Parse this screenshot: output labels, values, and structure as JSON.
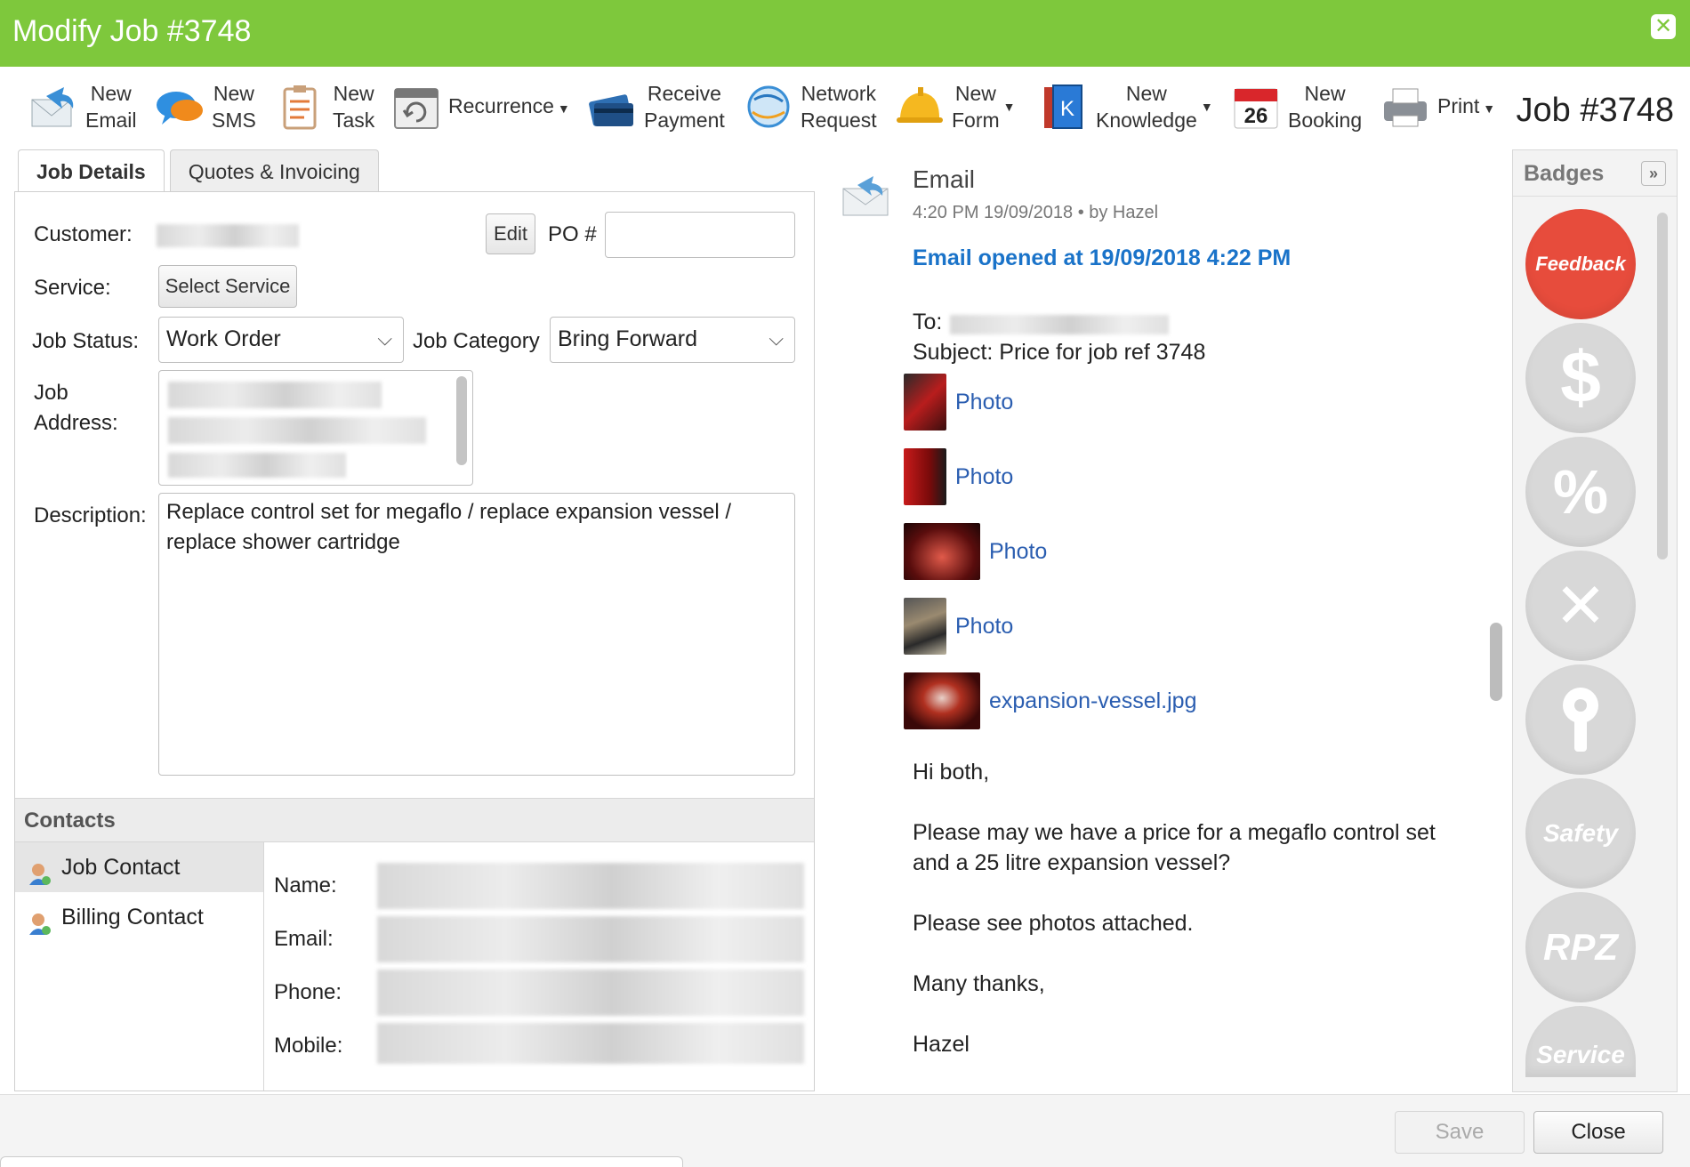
{
  "window": {
    "title": "Modify Job #3748",
    "close_glyph": "✕"
  },
  "toolbar": {
    "items": [
      {
        "l1": "New",
        "l2": "Email",
        "icon": "email-icon"
      },
      {
        "l1": "New",
        "l2": "SMS",
        "icon": "sms-icon"
      },
      {
        "l1": "New",
        "l2": "Task",
        "icon": "task-icon"
      },
      {
        "l1": "Recurrence",
        "l2": "",
        "icon": "recurrence-icon"
      },
      {
        "l1": "Receive",
        "l2": "Payment",
        "icon": "payment-card-icon"
      },
      {
        "l1": "Network",
        "l2": "Request",
        "icon": "network-globe-icon"
      },
      {
        "l1": "New",
        "l2": "Form",
        "icon": "form-helmet-icon"
      },
      {
        "l1": "New",
        "l2": "Knowledge",
        "icon": "knowledge-book-icon"
      },
      {
        "l1": "New",
        "l2": "Booking",
        "icon": "calendar-icon",
        "calendar_day": "26"
      },
      {
        "l1": "Print",
        "l2": "",
        "icon": "printer-icon"
      }
    ],
    "job_number": "Job #3748"
  },
  "tabs": [
    {
      "label": "Job Details",
      "active": true
    },
    {
      "label": "Quotes & Invoicing",
      "active": false
    }
  ],
  "form": {
    "customer_label": "Customer:",
    "edit_button": "Edit",
    "po_label": "PO #",
    "po_value": "",
    "service_label": "Service:",
    "select_service_button": "Select Service",
    "job_status_label": "Job Status:",
    "job_status_value": "Work Order",
    "job_category_label": "Job Category",
    "job_category_value": "Bring Forward",
    "job_address_label_1": "Job",
    "job_address_label_2": "Address:",
    "description_label": "Description:",
    "description_value": "Replace control set for megaflo / replace expansion vessel / replace shower cartridge"
  },
  "contacts": {
    "heading": "Contacts",
    "list": [
      {
        "label": "Job Contact",
        "active": true
      },
      {
        "label": "Billing Contact",
        "active": false
      }
    ],
    "fields": {
      "name_label": "Name:",
      "email_label": "Email:",
      "phone_label": "Phone:",
      "mobile_label": "Mobile:"
    }
  },
  "email": {
    "title": "Email",
    "meta": "4:20 PM 19/09/2018 •  by Hazel",
    "opened": "Email opened at 19/09/2018 4:22 PM",
    "to_label": "To:",
    "subject": "Subject: Price for job ref 3748",
    "attachments": [
      "Photo",
      "Photo",
      "Photo",
      "Photo",
      "expansion-vessel.jpg"
    ],
    "body": [
      "Hi both,",
      "Please may we have a price for a megaflo control set",
      "and a 25 litre expansion vessel?",
      "Please see photos attached.",
      "Many thanks,",
      "Hazel"
    ]
  },
  "badges": {
    "heading": "Badges",
    "expand_glyph": "»",
    "items": [
      {
        "label": "Feedback",
        "color": "#e74c3c"
      },
      {
        "label": "$",
        "color": "#d6d6d6"
      },
      {
        "label": "%",
        "color": "#d6d6d6"
      },
      {
        "label": "✕",
        "color": "#d6d6d6"
      },
      {
        "label": "",
        "color": "#d6d6d6"
      },
      {
        "label": "Safety",
        "color": "#d6d6d6"
      },
      {
        "label": "RPZ",
        "color": "#d6d6d6"
      },
      {
        "label": "Service",
        "color": "#d6d6d6"
      }
    ]
  },
  "footer": {
    "save_label": "Save",
    "close_label": "Close"
  },
  "colors": {
    "brand_green": "#7ec83c",
    "link_blue": "#1a73c9",
    "feedback_red": "#e74c3c"
  }
}
